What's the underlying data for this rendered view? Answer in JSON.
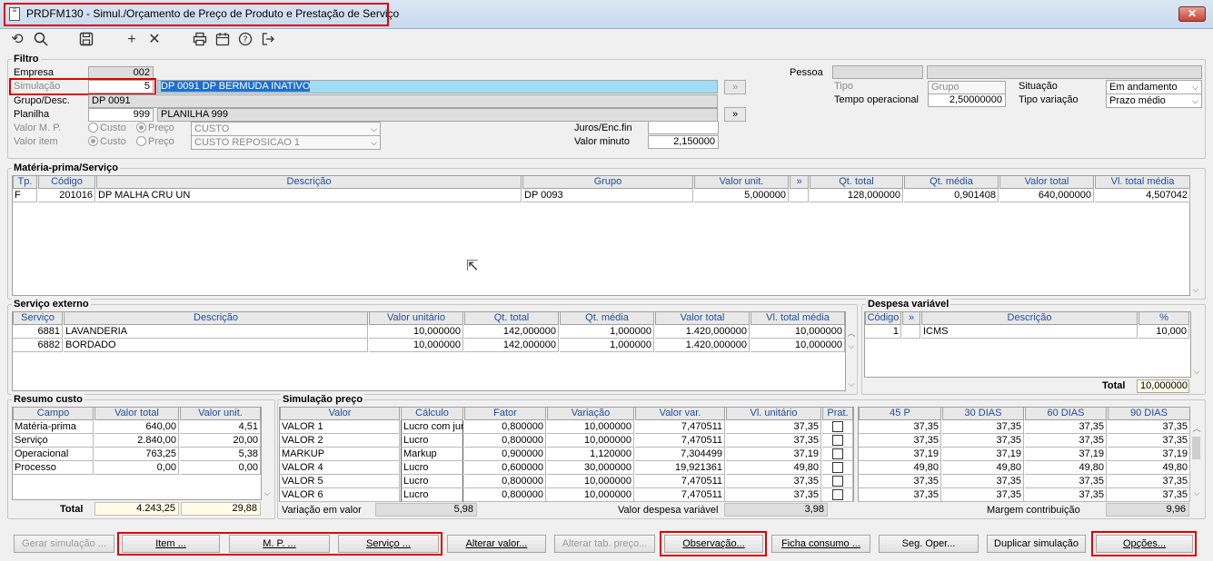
{
  "window": {
    "title": "PRDFM130 - Simul./Orçamento de Preço de Produto e Prestação de Serviço",
    "close": "✕"
  },
  "toolbar": {
    "icons": [
      "refresh-icon",
      "search-icon",
      "save-icon",
      "add-icon",
      "delete-icon",
      "print-icon",
      "calendar-icon",
      "help-icon",
      "exit-icon"
    ]
  },
  "filtro": {
    "title": "Filtro",
    "empresa_label": "Empresa",
    "empresa_value": "002",
    "simulacao_label": "Simulação",
    "simulacao_value": "5",
    "simulacao_desc": "DP 0091 DP BERMUDA INATIVO",
    "grupo_label": "Grupo/Desc.",
    "grupo_value": "DP 0091",
    "planilha_label": "Planilha",
    "planilha_value": "999",
    "planilha_desc": "PLANILHA 999",
    "valor_mp_label": "Valor M. P.",
    "valor_item_label": "Valor item",
    "custo_label": "Custo",
    "preco_label": "Preço",
    "valor_mp_combo": "CUSTO",
    "valor_item_combo": "CUSTO REPOSICAO 1",
    "juros_label": "Juros/Enc.fin",
    "juros_value": "",
    "valor_minuto_label": "Valor minuto",
    "valor_minuto_value": "2,150000",
    "expand_btn": "»",
    "pessoa_label": "Pessoa",
    "tipo_label": "Tipo",
    "tipo_value": "Grupo",
    "situacao_label": "Situação",
    "situacao_value": "Em andamento",
    "tempo_label": "Tempo operacional",
    "tempo_value": "2,50000000",
    "tipo_variacao_label": "Tipo variação",
    "tipo_variacao_value": "Prazo médio"
  },
  "mp": {
    "title": "Matéria-prima/Serviço",
    "headers": [
      "Tp.",
      "Código",
      "Descrição",
      "Grupo",
      "Valor unit.",
      "»",
      "Qt. total",
      "Qt. média",
      "Valor total",
      "Vl. total média"
    ],
    "rows": [
      [
        "F",
        "201016",
        "DP MALHA CRU UN",
        "DP 0093",
        "5,000000",
        "",
        "128,000000",
        "0,901408",
        "640,000000",
        "4,507042"
      ]
    ]
  },
  "servico": {
    "title": "Serviço externo",
    "headers": [
      "Serviço",
      "Descrição",
      "Valor unitário",
      "Qt. total",
      "Qt. média",
      "Valor total",
      "Vl. total média"
    ],
    "rows": [
      [
        "6881",
        "LAVANDERIA",
        "10,000000",
        "142,000000",
        "1,000000",
        "1.420,000000",
        "10,000000"
      ],
      [
        "6882",
        "BORDADO",
        "10,000000",
        "142,000000",
        "1,000000",
        "1.420,000000",
        "10,000000"
      ]
    ]
  },
  "despesa": {
    "title": "Despesa variável",
    "headers": [
      "Código",
      "»",
      "Descrição",
      "%"
    ],
    "rows": [
      [
        "1",
        "",
        "ICMS",
        "10,000"
      ]
    ],
    "total_label": "Total",
    "total_value": "10,000000"
  },
  "resumo": {
    "title": "Resumo custo",
    "headers": [
      "Campo",
      "Valor total",
      "Valor unit."
    ],
    "rows": [
      [
        "Matéria-prima",
        "640,00",
        "4,51"
      ],
      [
        "Serviço",
        "2.840,00",
        "20,00"
      ],
      [
        "Operacional",
        "763,25",
        "5,38"
      ],
      [
        "Processo",
        "0,00",
        "0,00"
      ]
    ],
    "total_label": "Total",
    "total_value": "4.243,25",
    "total_unit": "29,88"
  },
  "simulacao": {
    "title": "Simulação preço",
    "headers": [
      "Valor",
      "Cálculo",
      "Fator",
      "Variação",
      "Valor var.",
      "Vl. unitário",
      "Prat."
    ],
    "rows": [
      [
        "VALOR 1",
        "Lucro com juros",
        "0,800000",
        "10,000000",
        "7,470511",
        "37,35"
      ],
      [
        "VALOR 2",
        "Lucro",
        "0,800000",
        "10,000000",
        "7,470511",
        "37,35"
      ],
      [
        "MARKUP",
        "Markup",
        "0,900000",
        "1,120000",
        "7,304499",
        "37,19"
      ],
      [
        "VALOR 4",
        "Lucro",
        "0,600000",
        "30,000000",
        "19,921361",
        "49,80"
      ],
      [
        "VALOR 5",
        "Lucro",
        "0,800000",
        "10,000000",
        "7,470511",
        "37,35"
      ],
      [
        "VALOR 6",
        "Lucro",
        "0,800000",
        "10,000000",
        "7,470511",
        "37,35"
      ]
    ],
    "variacao_label": "Variação em valor",
    "variacao_value": "5,98",
    "despesa_label": "Valor despesa variável",
    "despesa_value": "3,98",
    "margem_label": "Margem contribuição",
    "margem_value": "9,96"
  },
  "prazos": {
    "headers": [
      "45 P",
      "30 DIAS",
      "60 DIAS",
      "90 DIAS"
    ],
    "rows": [
      [
        "37,35",
        "37,35",
        "37,35",
        "37,35"
      ],
      [
        "37,35",
        "37,35",
        "37,35",
        "37,35"
      ],
      [
        "37,19",
        "37,19",
        "37,19",
        "37,19"
      ],
      [
        "49,80",
        "49,80",
        "49,80",
        "49,80"
      ],
      [
        "37,35",
        "37,35",
        "37,35",
        "37,35"
      ],
      [
        "37,35",
        "37,35",
        "37,35",
        "37,35"
      ]
    ]
  },
  "buttons": {
    "gerar": "Gerar simulação ...",
    "item": "Item ...",
    "mp": "M. P. ...",
    "servico": "Serviço ...",
    "alterar_valor": "Alterar valor...",
    "alterar_tab": "Alterar tab. preço...",
    "observacao": "Observação...",
    "ficha": "Ficha consumo ...",
    "seg_oper": "Seg. Oper...",
    "duplicar": "Duplicar simulação",
    "opcoes": "Opções..."
  }
}
